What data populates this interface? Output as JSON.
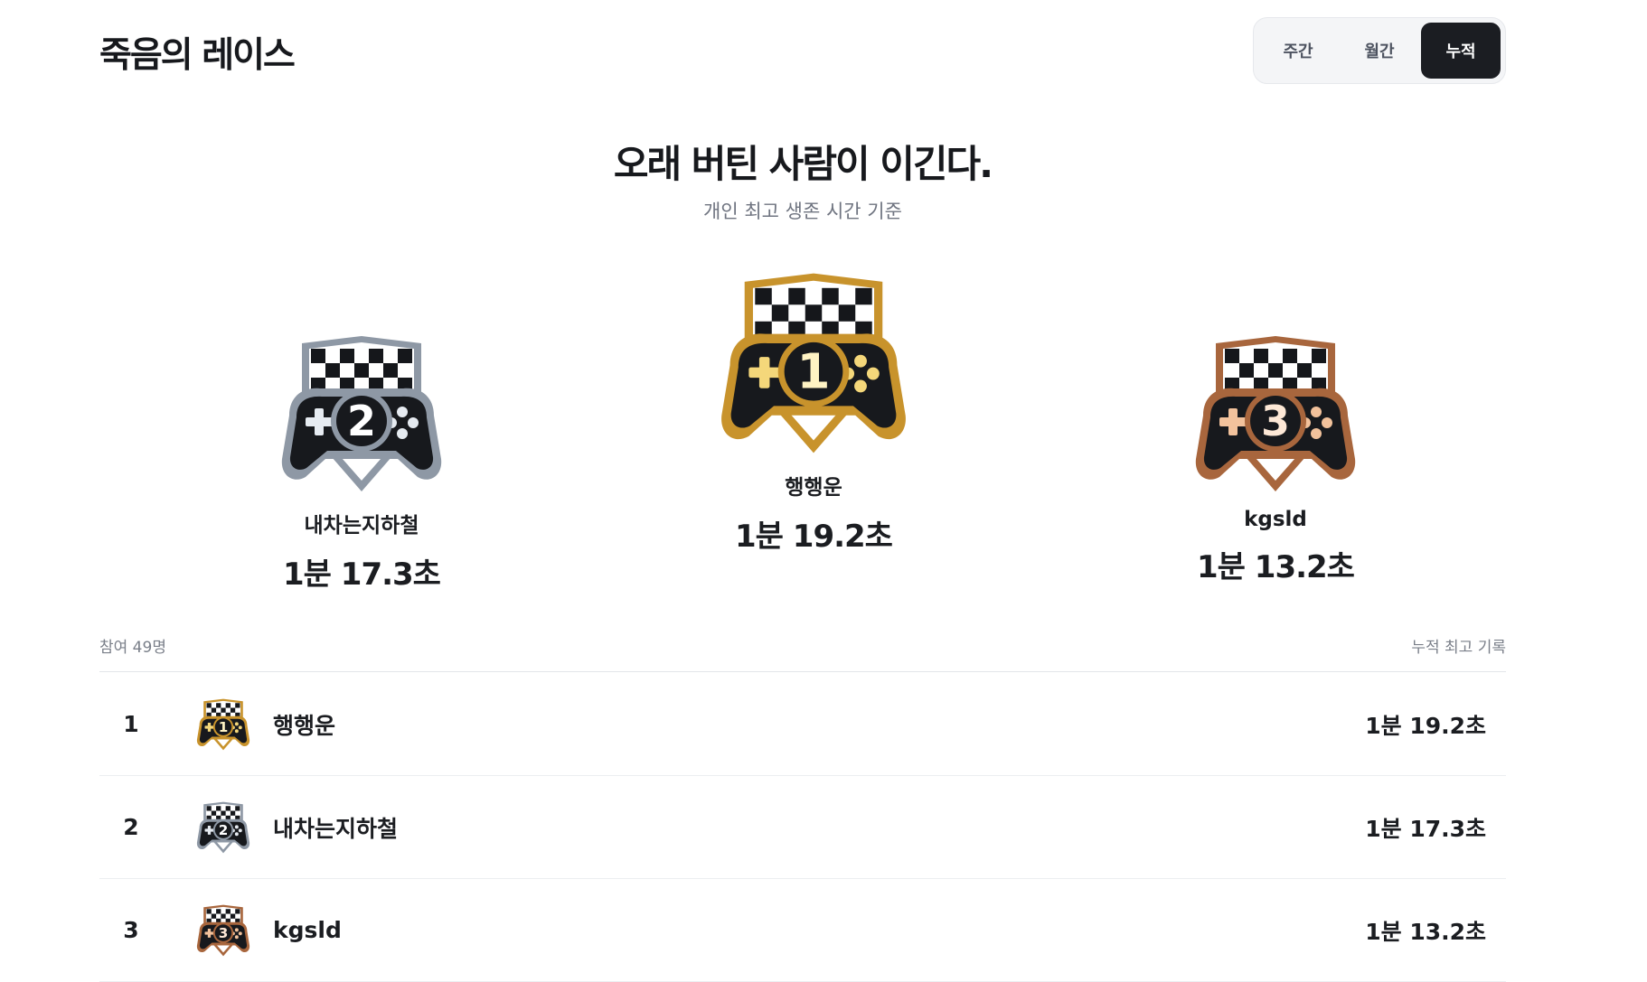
{
  "header": {
    "title": "죽음의 레이스",
    "tabs": [
      {
        "label": "주간",
        "active": false
      },
      {
        "label": "월간",
        "active": false
      },
      {
        "label": "누적",
        "active": true
      }
    ]
  },
  "hero": {
    "title": "오래 버틴 사람이 이긴다.",
    "subtitle": "개인 최고 생존 시간 기준"
  },
  "podium": [
    {
      "rank": "2",
      "name": "내차는지하철",
      "time": "1분 17.3초",
      "medal": "silver"
    },
    {
      "rank": "1",
      "name": "행행운",
      "time": "1분 19.2초",
      "medal": "gold"
    },
    {
      "rank": "3",
      "name": "kgsld",
      "time": "1분 13.2초",
      "medal": "bronze"
    }
  ],
  "list": {
    "participants": "참여 49명",
    "column": "누적 최고 기록",
    "rows": [
      {
        "rank": "1",
        "name": "행행운",
        "time": "1분 19.2초",
        "medal": "gold"
      },
      {
        "rank": "2",
        "name": "내차는지하철",
        "time": "1분 17.3초",
        "medal": "silver"
      },
      {
        "rank": "3",
        "name": "kgsld",
        "time": "1분 13.2초",
        "medal": "bronze"
      }
    ]
  },
  "medals": {
    "gold": {
      "rim": "#c8932c",
      "light": "#f4d77a",
      "num": "#fff3c4",
      "icon": "trophy-gamepad-gold-icon"
    },
    "silver": {
      "rim": "#8e98a5",
      "light": "#e6ebf1",
      "num": "#ffffff",
      "icon": "trophy-gamepad-silver-icon"
    },
    "bronze": {
      "rim": "#a8663d",
      "light": "#f2c29c",
      "num": "#fde8d6",
      "icon": "trophy-gamepad-bronze-icon"
    }
  }
}
